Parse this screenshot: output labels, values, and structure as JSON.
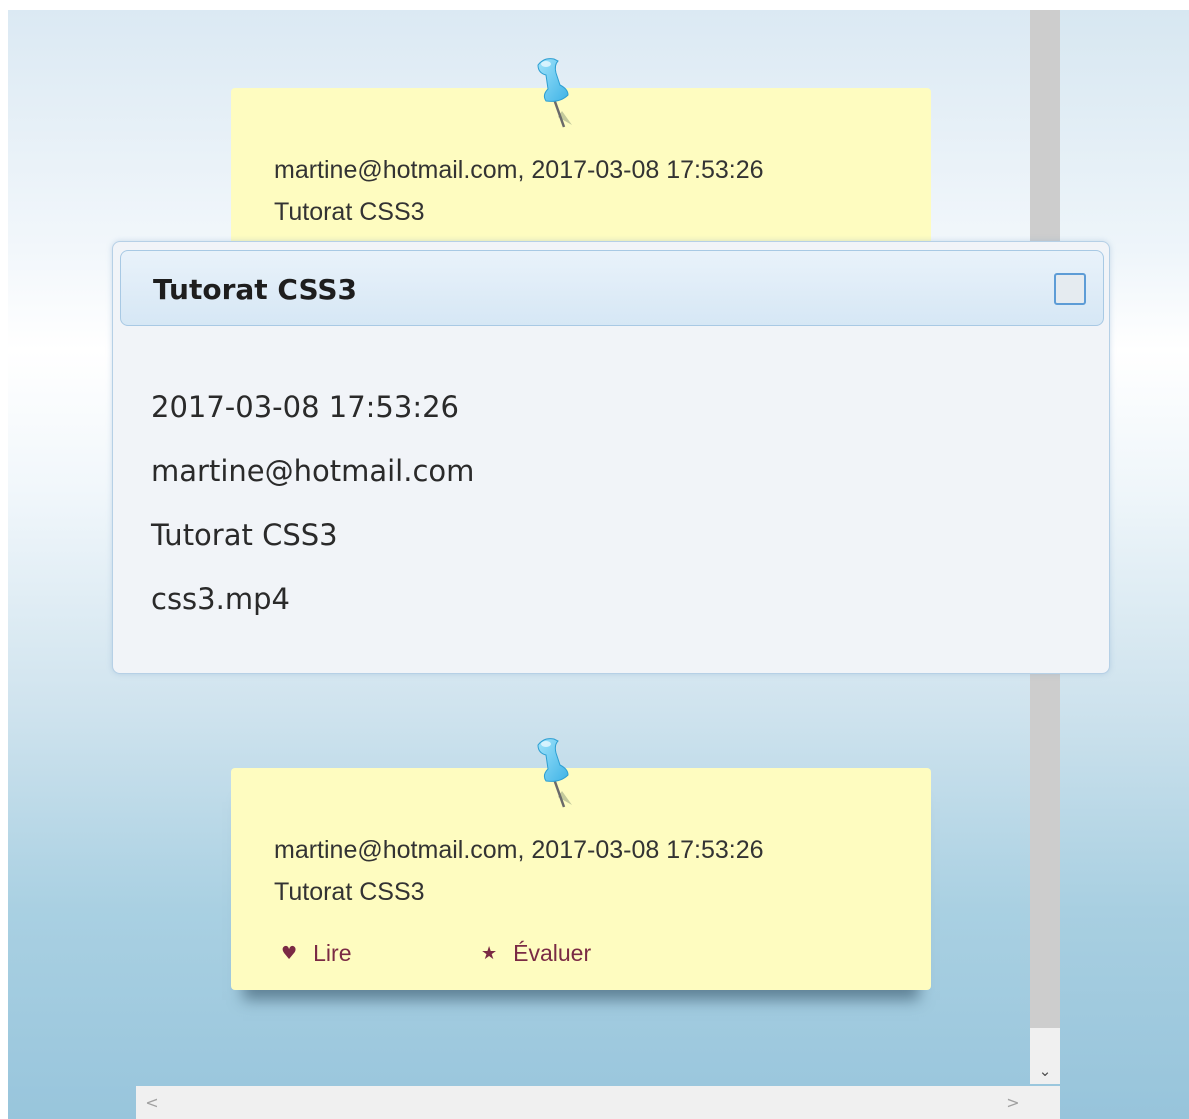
{
  "notes": [
    {
      "author_date": "martine@hotmail.com, 2017-03-08 17:53:26",
      "title": "Tutorat CSS3",
      "pin_icon": "pushpin-icon"
    },
    {
      "author_date": "martine@hotmail.com, 2017-03-08 17:53:26",
      "title": "Tutorat CSS3",
      "pin_icon": "pushpin-icon",
      "actions": [
        {
          "label": "Lire",
          "icon": "heart-icon",
          "glyph": "♥"
        },
        {
          "label": "Évaluer",
          "icon": "star-icon",
          "glyph": "★"
        }
      ]
    }
  ],
  "dialog": {
    "title": "Tutorat CSS3",
    "lines": [
      "2017-03-08 17:53:26",
      "martine@hotmail.com",
      "Tutorat CSS3",
      "css3.mp4"
    ]
  },
  "scrollbars": {
    "down_glyph": "⌄",
    "left_glyph": "<",
    "right_glyph": ">"
  },
  "colors": {
    "note_bg": "#fefcc0",
    "action_color": "#7a2a44",
    "dialog_border": "#b6d0e6",
    "close_border": "#5d9cd6"
  }
}
